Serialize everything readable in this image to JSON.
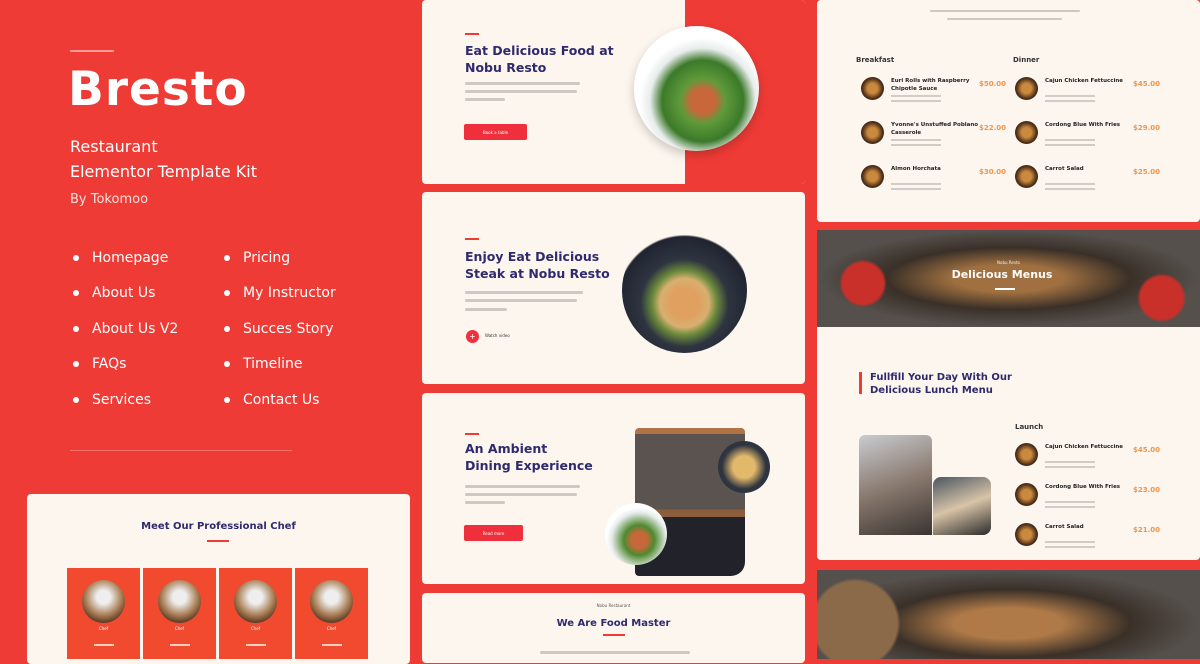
{
  "hero": {
    "title": "Bresto",
    "subtitle_line1": "Restaurant",
    "subtitle_line2": "Elementor Template Kit",
    "author": "By Tokomoo"
  },
  "pages_left": [
    "Homepage",
    "About Us",
    "About Us V2",
    "FAQs",
    "Services"
  ],
  "pages_right": [
    "Pricing",
    "My Instructor",
    "Succes Story",
    "Timeline",
    "Contact Us"
  ],
  "chef_section": {
    "title": "Meet Our Professional Chef",
    "chefs": [
      "Chef",
      "Chef",
      "Chef",
      "Chef"
    ]
  },
  "slides": [
    {
      "title_line1": "Eat Delicious Food at",
      "title_line2": "Nobu Resto",
      "button": "Book a table"
    },
    {
      "title_line1": "Enjoy Eat Delicious",
      "title_line2": "Steak at Nobu Resto",
      "button": "Watch video"
    },
    {
      "title_line1": "An Ambient",
      "title_line2": "Dining Experience",
      "button": "Read more"
    },
    {
      "eyebrow": "Nobu Restaurant",
      "title": "We Are Food Master"
    }
  ],
  "menu": {
    "breakfast_title": "Breakfast",
    "breakfast": [
      {
        "name": "Euri Rolls with Raspberry Chipotle Sauce",
        "price": "$50.00"
      },
      {
        "name": "Yvonne's Unstuffed Poblano Casserole",
        "price": "$22.00"
      },
      {
        "name": "Almon Horchata",
        "price": "$30.00"
      }
    ],
    "dinner_title": "Dinner",
    "dinner": [
      {
        "name": "Cajun Chicken Fettuccine",
        "price": "$45.00"
      },
      {
        "name": "Cordong Blue With Fries",
        "price": "$29.00"
      },
      {
        "name": "Carrot Salad",
        "price": "$25.00"
      }
    ]
  },
  "banner": {
    "eyebrow": "Nobu Resto",
    "title": "Delicious Menus"
  },
  "lunch": {
    "title_line1": "Fullfill Your Day With Our",
    "title_line2": "Delicious Lunch Menu",
    "list_title": "Launch",
    "items": [
      {
        "name": "Cajun Chicken Fettuccine",
        "price": "$45.00"
      },
      {
        "name": "Cordong Blue With Fries",
        "price": "$23.00"
      },
      {
        "name": "Carrot Salad",
        "price": "$21.00"
      }
    ]
  },
  "colors": {
    "brand_red": "#ef3b36",
    "cream": "#fdf6ee",
    "navy": "#2e2a6e",
    "price": "#f0954a"
  }
}
